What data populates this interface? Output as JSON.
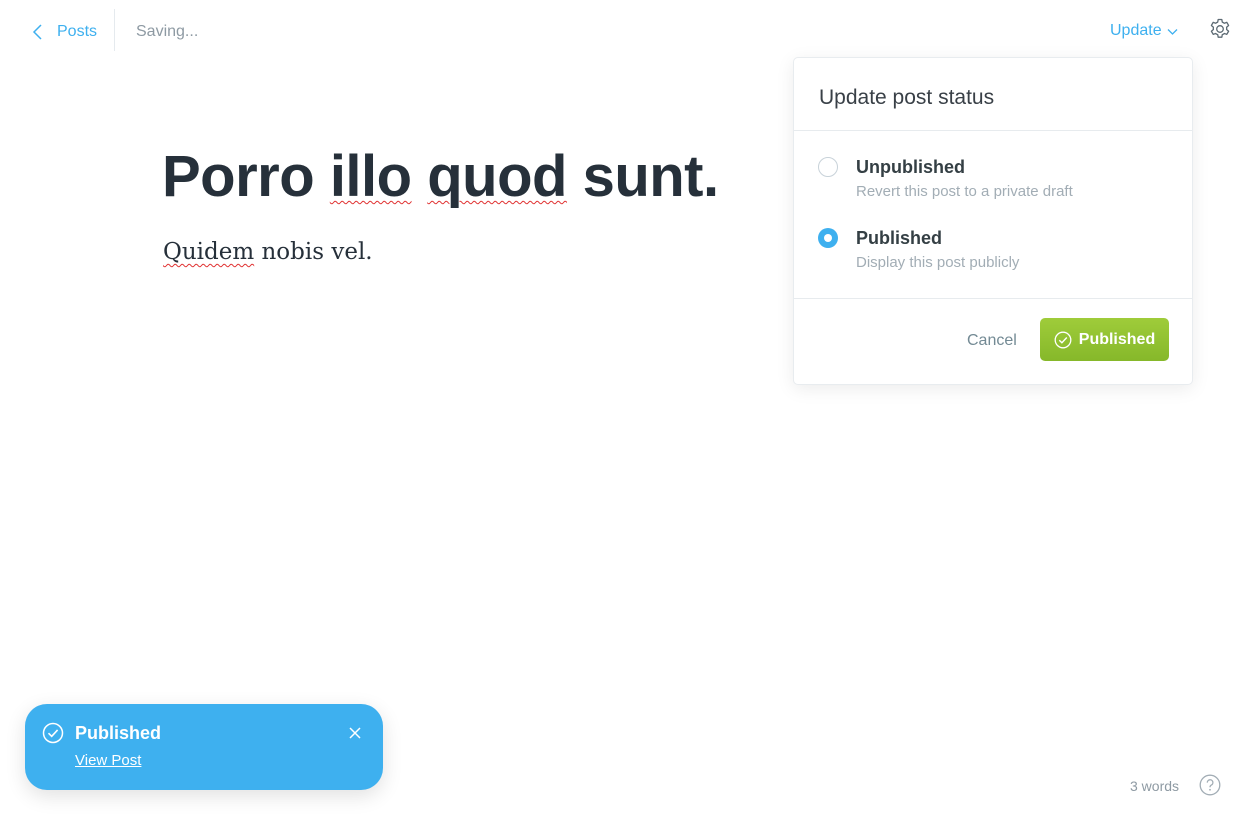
{
  "topbar": {
    "back_label": "Posts",
    "save_status": "Saving...",
    "update_label": "Update"
  },
  "editor": {
    "title_words": [
      "Porro",
      "illo",
      "quod",
      "sunt."
    ],
    "body_words": [
      "Quidem",
      "nobis vel."
    ]
  },
  "status_popover": {
    "title": "Update post status",
    "options": [
      {
        "label": "Unpublished",
        "description": "Revert this post to a private draft",
        "selected": false
      },
      {
        "label": "Published",
        "description": "Display this post publicly",
        "selected": true
      }
    ],
    "cancel_label": "Cancel",
    "confirm_label": "Published"
  },
  "toast": {
    "title": "Published",
    "link_label": "View Post"
  },
  "footer": {
    "word_count": "3 words"
  },
  "colors": {
    "accent": "#3eb0ef",
    "publish_green": "#8fbf2f",
    "spellcheck_red": "#e03030"
  }
}
